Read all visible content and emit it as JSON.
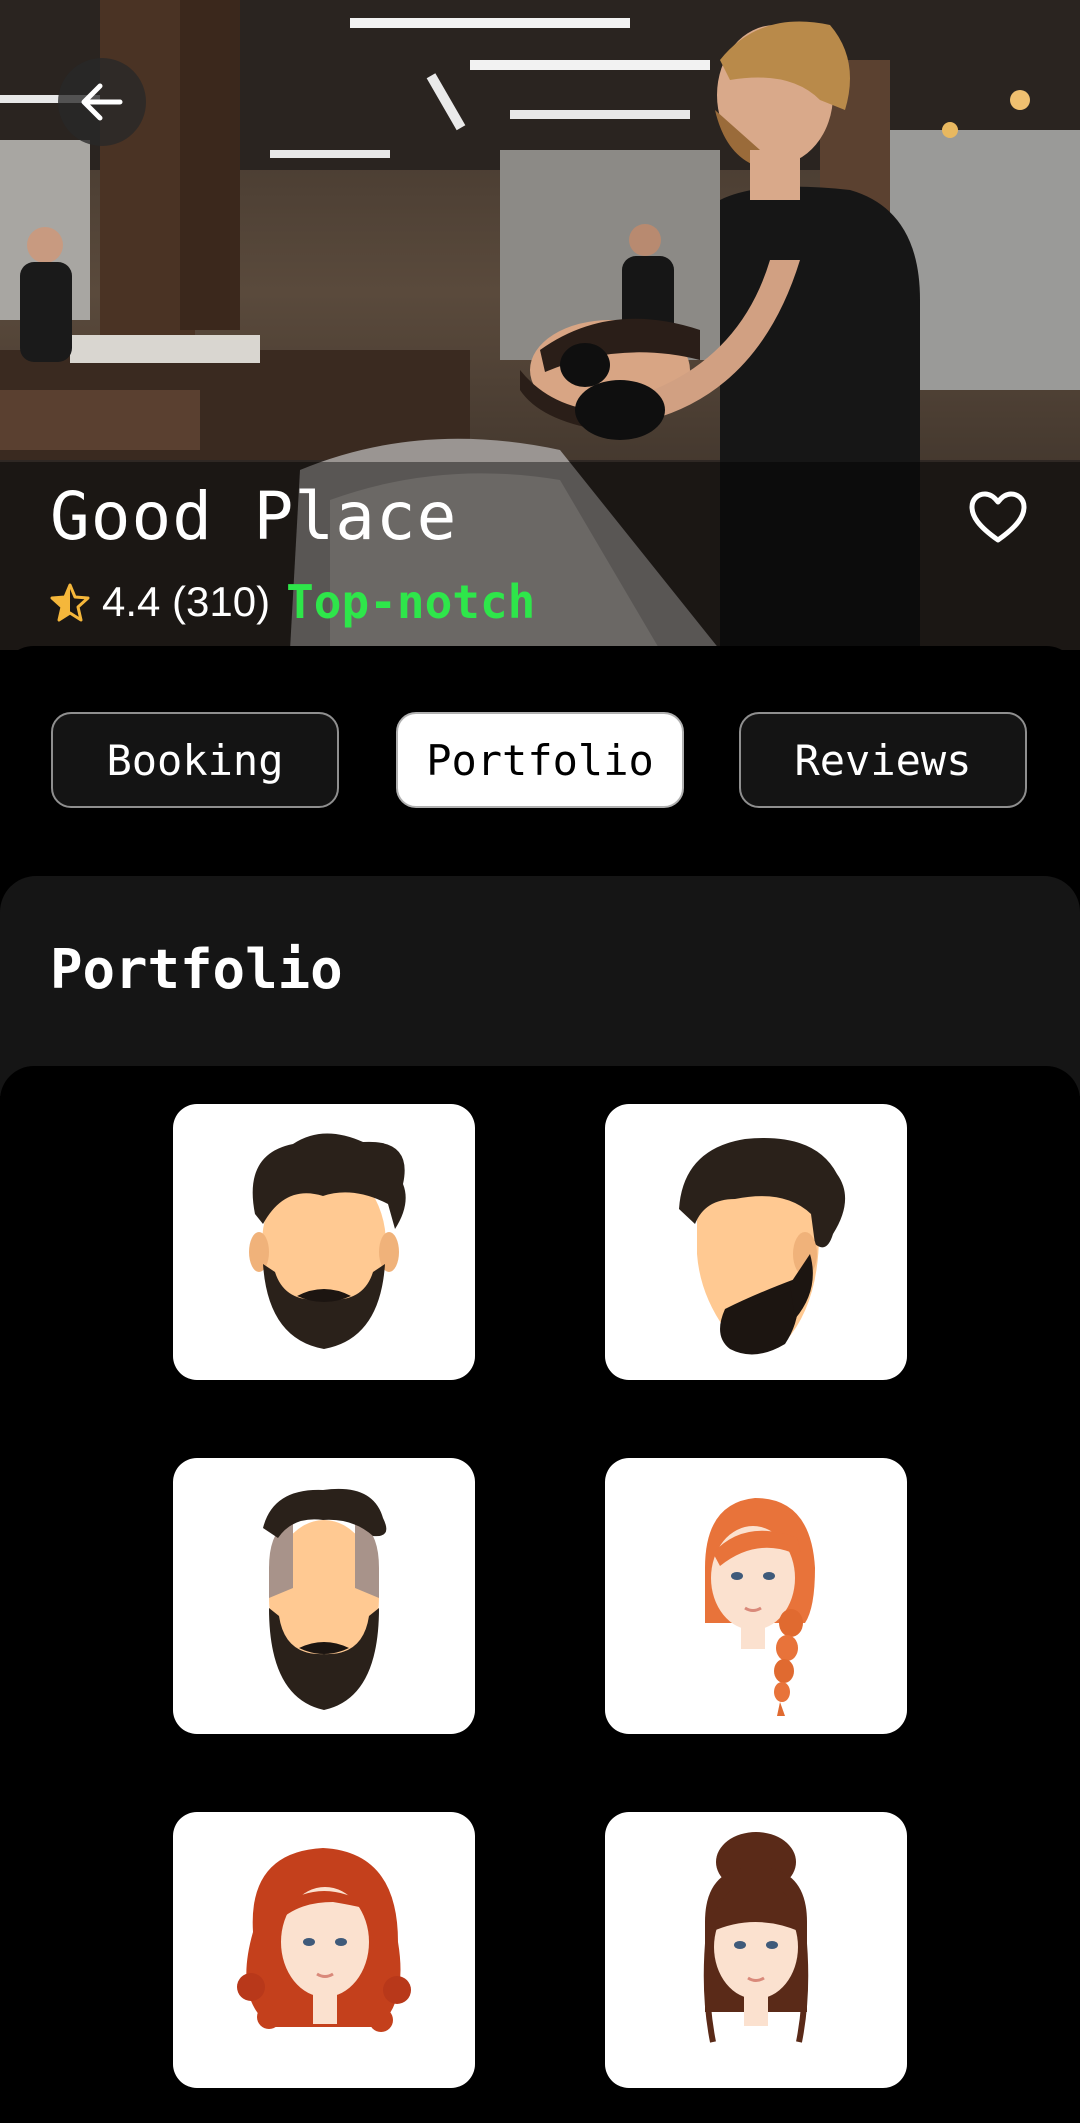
{
  "shop": {
    "name": "Good Place",
    "rating": "4.4 (310)",
    "rating_label": "Top-notch"
  },
  "tabs": [
    {
      "label": "Booking",
      "active": false
    },
    {
      "label": "Portfolio",
      "active": true
    },
    {
      "label": "Reviews",
      "active": false
    }
  ],
  "section": {
    "title": "Portfolio"
  },
  "portfolio": [
    {
      "icon": "beard-wavy-hair-icon"
    },
    {
      "icon": "goatee-curly-hair-icon"
    },
    {
      "icon": "full-beard-undercut-icon"
    },
    {
      "icon": "braided-red-hair-icon"
    },
    {
      "icon": "curly-red-hair-icon"
    },
    {
      "icon": "bun-bangs-hair-icon"
    }
  ],
  "colors": {
    "accent_green": "#2ee64a",
    "star": "#f5b73b",
    "background": "#000000",
    "card": "#151515"
  }
}
